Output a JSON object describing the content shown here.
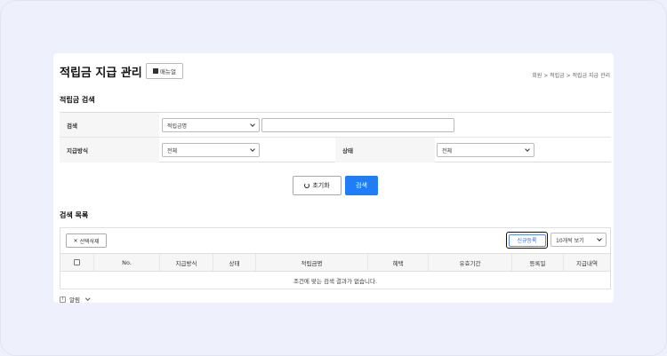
{
  "page": {
    "title": "적립금 지급 관리",
    "manual_label": "매뉴얼",
    "breadcrumb": "회원 > 적립금 > 적립금 지급 관리"
  },
  "search": {
    "section_title": "적립금 검색",
    "row1": {
      "label": "검색",
      "select_value": "적립금명",
      "input_value": ""
    },
    "row2": {
      "payment_label": "지급방식",
      "payment_value": "전체",
      "status_label": "상태",
      "status_value": "전체"
    },
    "reset_label": "초기화",
    "search_label": "검색"
  },
  "list": {
    "section_title": "검색 목록",
    "delete_label": "선택삭제",
    "new_label": "신규등록",
    "page_size_value": "10개씩 보기",
    "columns": [
      "No.",
      "지급방식",
      "상태",
      "적립금명",
      "혜택",
      "유효기간",
      "등록일",
      "지급내역"
    ],
    "empty_message": "조건에 맞는 검색 결과가 없습니다."
  },
  "notice": {
    "label": "알림",
    "icon_text": "i"
  },
  "colors": {
    "primary": "#1f7ef7",
    "background": "#eef0fb",
    "new_button_text": "#2a66d8"
  }
}
